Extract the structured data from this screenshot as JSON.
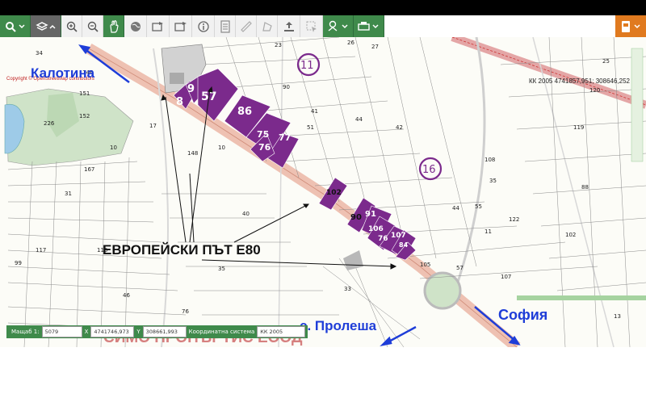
{
  "toolbar": {
    "buttons": [
      {
        "name": "search-button",
        "icon": "search-icon"
      },
      {
        "name": "layers-button",
        "icon": "layers-icon"
      },
      {
        "name": "zoom-in-button",
        "icon": "zoom-in-icon"
      },
      {
        "name": "zoom-out-button",
        "icon": "zoom-out-icon"
      },
      {
        "name": "pan-button",
        "icon": "hand-icon"
      },
      {
        "name": "globe-button",
        "icon": "globe-icon"
      },
      {
        "name": "previous-extent-button",
        "icon": "back-extent-icon"
      },
      {
        "name": "next-extent-button",
        "icon": "forward-extent-icon"
      },
      {
        "name": "info-button",
        "icon": "info-icon"
      },
      {
        "name": "legend-button",
        "icon": "legend-icon"
      },
      {
        "name": "measure-button",
        "icon": "ruler-icon"
      },
      {
        "name": "area-button",
        "icon": "polygon-icon"
      },
      {
        "name": "upload-button",
        "icon": "upload-icon"
      },
      {
        "name": "select-button",
        "icon": "select-icon"
      },
      {
        "name": "draw-button",
        "icon": "pin-icon"
      },
      {
        "name": "print-button",
        "icon": "print-icon"
      },
      {
        "name": "user-button",
        "icon": "user-icon"
      }
    ]
  },
  "map": {
    "copyright": "Copyright © OpenStreetMap contributors",
    "crs_readout": "КК 2005 4741857,951; 308646,252",
    "labels": {
      "kalotina": "Калотина",
      "sofia": "София",
      "proleshа": "с. Пролеша",
      "road": "ЕВРОПЕЙСКИ ПЪТ Е80",
      "watermark": "СИМО ПРОПЪРТИС ЕООД"
    },
    "purple_parcels": [
      "8",
      "9",
      "57",
      "86",
      "75",
      "77",
      "76",
      "102",
      "90",
      "91",
      "106",
      "76",
      "107",
      "84"
    ],
    "circled_parcels": [
      "11",
      "16"
    ],
    "colors": {
      "parcel_fill": "#7b2a8c",
      "road": "#e9b7a6",
      "label_blue": "#1e3dd8",
      "watermark": "#d06b6b",
      "toolbar_green": "#3f8a4b"
    }
  },
  "coordbar": {
    "scale_label": "Мащаб 1:",
    "scale_value": "5079",
    "x_label": "X",
    "x_value": "4741746,973",
    "y_label": "Y",
    "y_value": "308661,993",
    "crs_label": "Координатна система",
    "crs_value": "КК 2005"
  }
}
